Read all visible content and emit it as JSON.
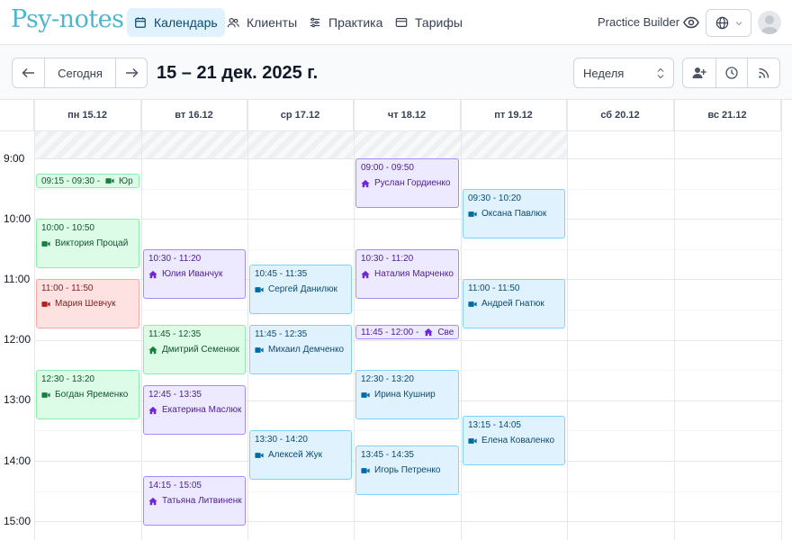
{
  "app": {
    "logo": "Psy-notes",
    "nav": [
      {
        "label": "Календарь",
        "icon": "calendar-icon",
        "active": true
      },
      {
        "label": "Клиенты",
        "icon": "users-icon",
        "active": false
      },
      {
        "label": "Практика",
        "icon": "sliders-icon",
        "active": false
      },
      {
        "label": "Тарифы",
        "icon": "card-icon",
        "active": false
      }
    ],
    "practice_builder": "Practice Builder"
  },
  "toolbar": {
    "prev_icon": "arrow-left-icon",
    "today_label": "Сегодня",
    "next_icon": "arrow-right-icon",
    "range_title": "15 – 21 дек. 2025 г.",
    "view_select": "Неделя"
  },
  "calendar": {
    "days": [
      "пн 15.12",
      "вт 16.12",
      "ср 17.12",
      "чт 18.12",
      "пт 19.12",
      "сб 20.12",
      "вс 21.12"
    ],
    "hours": [
      "9:00",
      "10:00",
      "11:00",
      "12:00",
      "13:00",
      "14:00",
      "15:00"
    ],
    "events": [
      {
        "day": 0,
        "start": "09:15",
        "end": "09:30",
        "time": "09:15 - 09:30 -",
        "name": "Юр",
        "type": "video",
        "color": "green",
        "inline": true
      },
      {
        "day": 0,
        "start": "10:00",
        "end": "10:50",
        "time": "10:00 - 10:50",
        "name": "Виктория Процай",
        "type": "video",
        "color": "green"
      },
      {
        "day": 0,
        "start": "11:00",
        "end": "11:50",
        "time": "11:00 - 11:50",
        "name": "Мария Шевчук",
        "type": "video",
        "color": "red"
      },
      {
        "day": 0,
        "start": "12:30",
        "end": "13:20",
        "time": "12:30 - 13:20",
        "name": "Богдан Яременко",
        "type": "video",
        "color": "green"
      },
      {
        "day": 1,
        "start": "10:30",
        "end": "11:20",
        "time": "10:30 - 11:20",
        "name": "Юлия Иванчук",
        "type": "home",
        "color": "purple"
      },
      {
        "day": 1,
        "start": "11:45",
        "end": "12:35",
        "time": "11:45 - 12:35",
        "name": "Дмитрий Семенюк",
        "type": "home",
        "color": "green"
      },
      {
        "day": 1,
        "start": "12:45",
        "end": "13:35",
        "time": "12:45 - 13:35",
        "name": "Екатерина Маслюк",
        "type": "home",
        "color": "purple"
      },
      {
        "day": 1,
        "start": "14:15",
        "end": "15:05",
        "time": "14:15 - 15:05",
        "name": "Татьяна Литвиненк",
        "type": "home",
        "color": "purple"
      },
      {
        "day": 2,
        "start": "10:45",
        "end": "11:35",
        "time": "10:45 - 11:35",
        "name": "Сергей Данилюк",
        "type": "video",
        "color": "blue"
      },
      {
        "day": 2,
        "start": "11:45",
        "end": "12:35",
        "time": "11:45 - 12:35",
        "name": "Михаил Демченко",
        "type": "video",
        "color": "blue"
      },
      {
        "day": 2,
        "start": "13:30",
        "end": "14:20",
        "time": "13:30 - 14:20",
        "name": "Алексей Жук",
        "type": "video",
        "color": "blue"
      },
      {
        "day": 3,
        "start": "09:00",
        "end": "09:50",
        "time": "09:00 - 09:50",
        "name": "Руслан Гордиенко",
        "type": "home",
        "color": "purple"
      },
      {
        "day": 3,
        "start": "10:30",
        "end": "11:20",
        "time": "10:30 - 11:20",
        "name": "Наталия Марченко",
        "type": "home",
        "color": "purple"
      },
      {
        "day": 3,
        "start": "11:45",
        "end": "12:00",
        "time": "11:45 - 12:00 -",
        "name": "Све",
        "type": "home",
        "color": "purple",
        "inline": true
      },
      {
        "day": 3,
        "start": "12:30",
        "end": "13:20",
        "time": "12:30 - 13:20",
        "name": "Ирина Кушнир",
        "type": "video",
        "color": "blue"
      },
      {
        "day": 3,
        "start": "13:45",
        "end": "14:35",
        "time": "13:45 - 14:35",
        "name": "Игорь Петренко",
        "type": "video",
        "color": "blue"
      },
      {
        "day": 4,
        "start": "09:30",
        "end": "10:20",
        "time": "09:30 - 10:20",
        "name": "Оксана Павлюк",
        "type": "video",
        "color": "blue"
      },
      {
        "day": 4,
        "start": "11:00",
        "end": "11:50",
        "time": "11:00 - 11:50",
        "name": "Андрей Гнатюк",
        "type": "video",
        "color": "blue"
      },
      {
        "day": 4,
        "start": "13:15",
        "end": "14:05",
        "time": "13:15 - 14:05",
        "name": "Елена Коваленко",
        "type": "video",
        "color": "blue"
      }
    ]
  }
}
